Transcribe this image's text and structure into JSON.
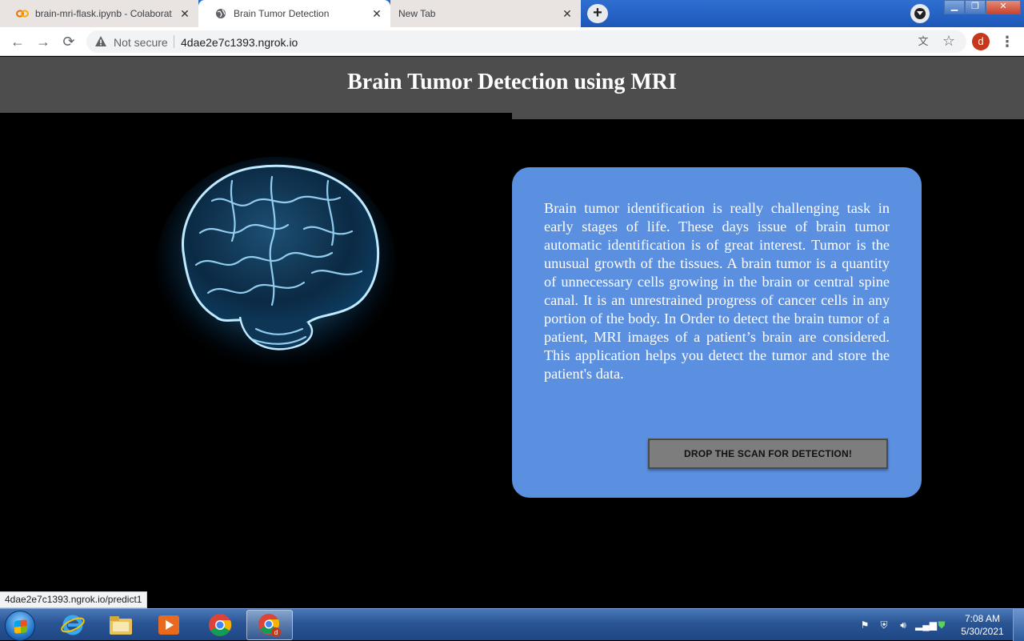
{
  "browser": {
    "tabs": [
      {
        "label": "brain-mri-flask.ipynb - Colaborat",
        "icon": "colab-icon"
      },
      {
        "label": "Brain Tumor Detection",
        "icon": "globe-icon"
      },
      {
        "label": "New Tab",
        "icon": ""
      }
    ],
    "security_text": "Not secure",
    "url": "4dae2e7c1393.ngrok.io",
    "profile_initial": "d",
    "status_link": "4dae2e7c1393.ngrok.io/predict1"
  },
  "page": {
    "title": "Brain Tumor Detection using MRI",
    "description": "Brain tumor identification is really challenging task in early stages of life. These days issue of brain tumor automatic identification is of great interest. Tumor is the unusual growth of the tissues. A brain tumor is a quantity of unnecessary cells growing in the brain or central spine canal. It is an unrestrained progress of cancer cells in any portion of the body. In Order to detect the brain tumor of a patient, MRI images of a patient’s brain are considered. This application helps you detect the tumor and store the patient's data.",
    "drop_button_label": "DROP THE SCAN FOR DETECTION!",
    "colors": {
      "header": "#4d4d4d",
      "card": "#5b8fe0",
      "button": "#7d7d7d",
      "background": "#000000"
    }
  },
  "taskbar": {
    "apps": [
      "internet-explorer-icon",
      "file-explorer-icon",
      "media-player-icon",
      "chrome-icon",
      "chrome-profile-icon"
    ],
    "time": "7:08 AM",
    "date": "5/30/2021"
  }
}
